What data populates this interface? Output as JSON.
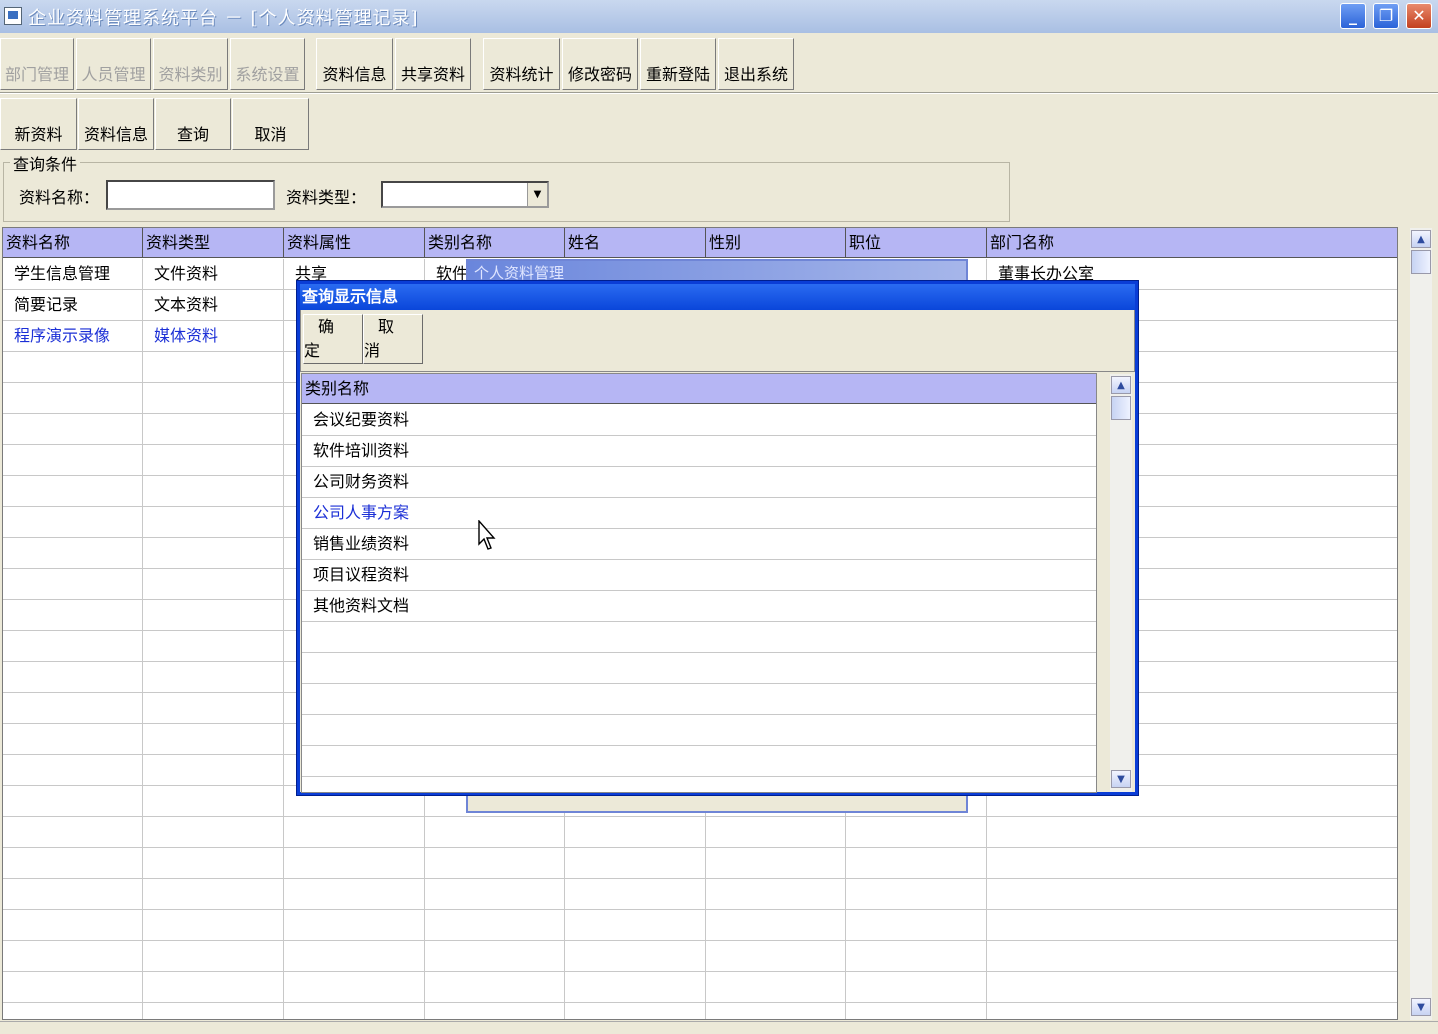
{
  "window": {
    "title": "企业资料管理系统平台 － [个人资料管理记录]",
    "min_label": "_",
    "max_label": "❐",
    "close_label": "✕"
  },
  "toolbar": {
    "buttons": [
      {
        "label": "部门管理",
        "enabled": false
      },
      {
        "label": "人员管理",
        "enabled": false
      },
      {
        "label": "资料类别",
        "enabled": false
      },
      {
        "label": "系统设置",
        "enabled": false
      },
      {
        "label": "资料信息",
        "enabled": true
      },
      {
        "label": "共享资料",
        "enabled": true
      },
      {
        "label": "资料统计",
        "enabled": true
      },
      {
        "label": "修改密码",
        "enabled": true
      },
      {
        "label": "重新登陆",
        "enabled": true
      },
      {
        "label": "退出系统",
        "enabled": true
      }
    ]
  },
  "subtoolbar": {
    "new_label": "新资料",
    "info_label": "资料信息",
    "query_label": "查询",
    "cancel_label": "取消"
  },
  "query": {
    "legend": "查询条件",
    "name_label": "资料名称：",
    "name_value": "",
    "type_label": "资料类型：",
    "type_value": ""
  },
  "grid": {
    "columns": [
      "资料名称",
      "资料类型",
      "资料属性",
      "类别名称",
      "姓名",
      "性别",
      "职位",
      "部门名称"
    ],
    "rows": [
      {
        "name": "学生信息管理",
        "type": "文件资料",
        "attr": "共享",
        "category": "软件",
        "dept": "董事长办公室",
        "selected": false
      },
      {
        "name": "简要记录",
        "type": "文本资料",
        "attr": "",
        "category": "",
        "dept": "",
        "selected": false
      },
      {
        "name": "程序演示录像",
        "type": "媒体资料",
        "attr": "",
        "category": "",
        "dept": "",
        "selected": true
      }
    ]
  },
  "background_window": {
    "title": "个人资料管理"
  },
  "dialog": {
    "title": "查询显示信息",
    "ok_label": "确定",
    "cancel_label": "取消",
    "column": "类别名称",
    "items": [
      {
        "label": "会议纪要资料",
        "selected": false
      },
      {
        "label": "软件培训资料",
        "selected": false
      },
      {
        "label": "公司财务资料",
        "selected": false
      },
      {
        "label": "公司人事方案",
        "selected": true
      },
      {
        "label": "销售业绩资料",
        "selected": false
      },
      {
        "label": "项目议程资料",
        "selected": false
      },
      {
        "label": "其他资料文档",
        "selected": false
      }
    ]
  },
  "colors": {
    "header_bg": "#b6b6f4",
    "selected_text": "#1b2fd6",
    "dialog_border": "#0a3dd6"
  }
}
